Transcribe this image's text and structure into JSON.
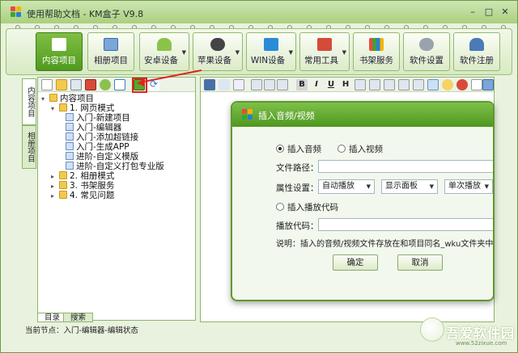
{
  "window": {
    "title": "使用帮助文档 - KM盒子 V9.8"
  },
  "toolbar": {
    "buttons": [
      {
        "label": "内容项目",
        "icon": "book-icon",
        "active": true
      },
      {
        "label": "相册项目",
        "icon": "photo-icon"
      },
      {
        "label": "安卓设备",
        "icon": "android-icon",
        "dropdown": true
      },
      {
        "label": "苹果设备",
        "icon": "apple-icon",
        "dropdown": true
      },
      {
        "label": "WIN设备",
        "icon": "windows-icon",
        "dropdown": true
      },
      {
        "label": "常用工具",
        "icon": "tools-icon",
        "dropdown": true
      },
      {
        "label": "书架服务",
        "icon": "bookshelf-icon"
      },
      {
        "label": "软件设置",
        "icon": "gear-icon"
      },
      {
        "label": "软件注册",
        "icon": "user-icon"
      }
    ]
  },
  "side_tabs": {
    "content": "内容项目",
    "album": "相册项目"
  },
  "tree": {
    "root": "内容项目",
    "items": [
      {
        "label": "1. 网页模式",
        "type": "folder",
        "level": 1,
        "expanded": true
      },
      {
        "label": "入门-新建项目",
        "type": "page",
        "level": 2
      },
      {
        "label": "入门-编辑器",
        "type": "page",
        "level": 2
      },
      {
        "label": "入门-添加超链接",
        "type": "page",
        "level": 2
      },
      {
        "label": "入门-生成APP",
        "type": "page",
        "level": 2
      },
      {
        "label": "进阶-自定义模版",
        "type": "page",
        "level": 2
      },
      {
        "label": "进阶-自定义打包专业版",
        "type": "page",
        "level": 2
      },
      {
        "label": "2. 相册模式",
        "type": "folder",
        "level": 1
      },
      {
        "label": "3. 书架服务",
        "type": "folder",
        "level": 1
      },
      {
        "label": "4. 常见问题",
        "type": "folder",
        "level": 1
      }
    ]
  },
  "bottom_tabs": {
    "catalog": "目录",
    "search": "搜索"
  },
  "status": {
    "text": "当前节点：入门-编辑器-编辑状态"
  },
  "editor_toolbar": {
    "bold": "B",
    "italic": "I",
    "underline": "U",
    "heading": "H"
  },
  "dialog": {
    "title": "插入音频/视频",
    "radio_audio": "插入音频",
    "radio_video": "插入视频",
    "file_path_label": "文件路径：",
    "file_path_value": "",
    "attr_label": "属性设置：",
    "select_autoplay": "自动播放",
    "select_panel": "显示面板",
    "select_loop": "单次播放",
    "radio_code": "插入播放代码",
    "code_label": "播放代码：",
    "code_value": "",
    "note": "说明：插入的音频/视频文件存放在和项目同名_wku文件夹中",
    "ok": "确定",
    "cancel": "取消"
  },
  "watermark": {
    "text": "吾爱软件园",
    "url": "www.52zixue.com"
  },
  "colors": {
    "accent": "#5ca52a",
    "highlight": "#e0241f"
  }
}
